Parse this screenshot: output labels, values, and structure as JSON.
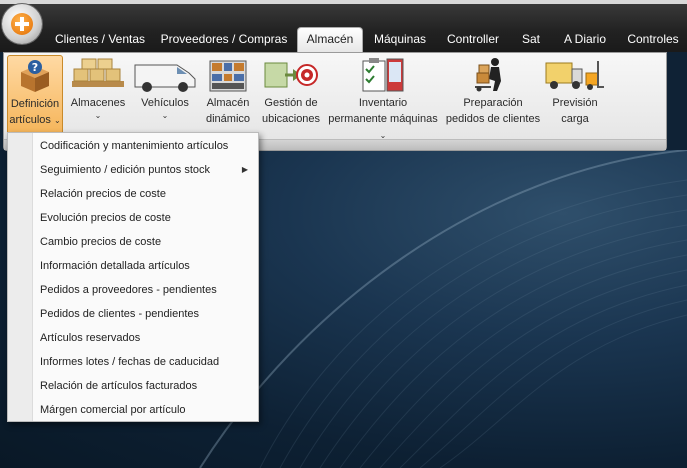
{
  "tabs": [
    {
      "label": "Clientes / Ventas"
    },
    {
      "label": "Proveedores / Compras"
    },
    {
      "label": "Almacén"
    },
    {
      "label": "Máquinas"
    },
    {
      "label": "Controller"
    },
    {
      "label": "Sat"
    },
    {
      "label": "A Diario"
    },
    {
      "label": "Controles"
    }
  ],
  "active_tab": "Almacén",
  "ribbon": {
    "buttons": [
      {
        "line1": "Definición",
        "line2": "artículos",
        "icon": "question-box-icon"
      },
      {
        "line1": "Almacenes",
        "line2": "",
        "icon": "pallet-boxes-icon"
      },
      {
        "line1": "Vehículos",
        "line2": "",
        "icon": "van-icon"
      },
      {
        "line1": "Almacén",
        "line2": "dinámico",
        "icon": "warehouse-shelves-icon"
      },
      {
        "line1": "Gestión de",
        "line2": "ubicaciones",
        "icon": "target-location-icon"
      },
      {
        "line1": "Inventario",
        "line2": "permanente máquinas",
        "icon": "checklist-icon"
      },
      {
        "line1": "Preparación",
        "line2": "pedidos de clientes",
        "icon": "hand-truck-icon"
      },
      {
        "line1": "Previsión",
        "line2": "carga",
        "icon": "truck-forklift-icon"
      }
    ],
    "caret": "⌄"
  },
  "dropdown": {
    "items": [
      {
        "label": "Codificación y mantenimiento artículos"
      },
      {
        "label": "Seguimiento / edición puntos stock",
        "submenu": "▶"
      },
      {
        "label": "Relación precios de coste"
      },
      {
        "label": "Evolución precios de coste"
      },
      {
        "label": "Cambio precios de coste"
      },
      {
        "label": "Información detallada artículos"
      },
      {
        "label": "Pedidos a proveedores - pendientes"
      },
      {
        "label": "Pedidos de clientes - pendientes"
      },
      {
        "label": "Artículos reservados"
      },
      {
        "label": "Informes lotes / fechas de caducidad"
      },
      {
        "label": "Relación de artículos facturados"
      },
      {
        "label": "Márgen comercial por artículo"
      }
    ]
  },
  "colors": {
    "active_button": "#f5b458",
    "background": "#0f2235",
    "tab_bar": "#222222"
  }
}
